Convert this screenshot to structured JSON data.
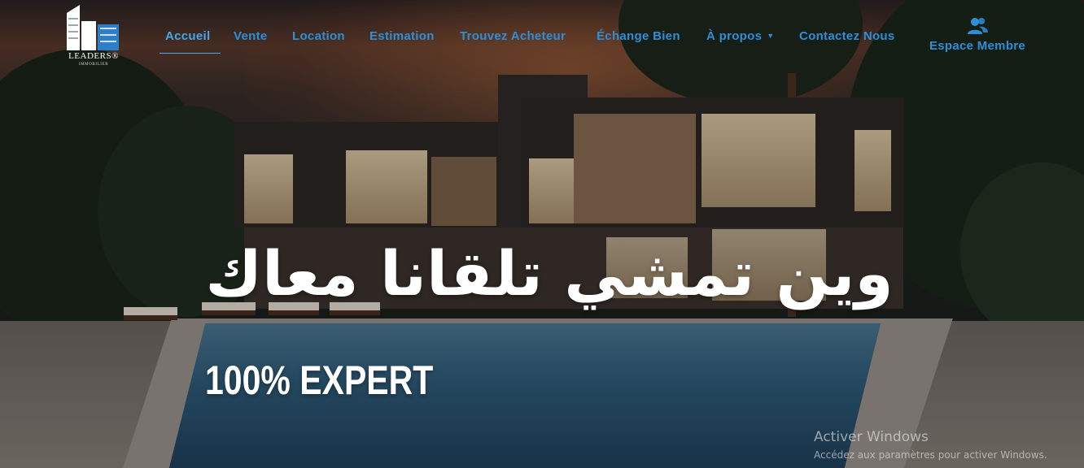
{
  "brand": {
    "name": "LEADERS®",
    "subtitle": "IMMOBILIER"
  },
  "nav": {
    "items": [
      {
        "label": "Accueil",
        "active": true
      },
      {
        "label": "Vente"
      },
      {
        "label": "Location"
      },
      {
        "label": "Estimation"
      },
      {
        "label": "Trouvez Acheteur"
      },
      {
        "label": "Échange Bien"
      },
      {
        "label": "À propos",
        "dropdown": true
      },
      {
        "label": "Contactez Nous"
      }
    ],
    "member": {
      "label": "Espace Membre",
      "icon": "users-icon"
    }
  },
  "hero": {
    "headline_ar": "وين تمشي تلقانا معاك",
    "headline_en": "100% EXPERT"
  },
  "windows_activation": {
    "title": "Activer Windows",
    "subtitle": "Accédez aux paramètres pour activer Windows."
  },
  "colors": {
    "nav_text": "#2c8fd8",
    "nav_active": "#48a5ec",
    "headline": "#ffffff"
  }
}
